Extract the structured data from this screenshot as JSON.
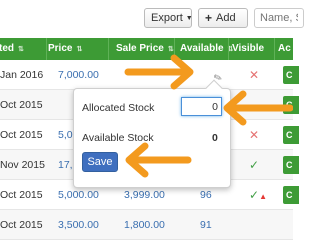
{
  "toolbar": {
    "export_label": "Export",
    "add_label": "Add",
    "search_placeholder": "Name, S"
  },
  "table": {
    "headers": [
      "ted",
      "Price",
      "Sale Price",
      "Available",
      "Visible",
      "Ac"
    ],
    "rows": [
      {
        "date": "Jan 2016",
        "price": "7,000.00",
        "sale": "",
        "available": "",
        "visible": "x",
        "action": "C"
      },
      {
        "date": "Oct 2015",
        "price": "",
        "sale": "",
        "available": "",
        "visible": "",
        "action": "C"
      },
      {
        "date": "Oct 2015",
        "price": "5,00",
        "sale": "",
        "available": "",
        "visible": "x",
        "action": "C"
      },
      {
        "date": "Nov 2015",
        "price": "17,50",
        "sale": "",
        "available": "",
        "visible": "check",
        "action": "C"
      },
      {
        "date": "Oct 2015",
        "price": "5,000.00",
        "sale": "3,999.00",
        "available": "96",
        "visible": "check-warn",
        "action": "C"
      },
      {
        "date": "Oct 2015",
        "price": "3,500.00",
        "sale": "1,800.00",
        "available": "91",
        "visible": "",
        "action": ""
      }
    ]
  },
  "popover": {
    "allocated_label": "Allocated Stock",
    "allocated_value": "0",
    "available_label": "Available Stock",
    "available_value": "0",
    "save_label": "Save"
  },
  "colors": {
    "header_green": "#3d9b35",
    "annotation_orange": "#f39a1e",
    "save_blue": "#3f6fbf"
  }
}
